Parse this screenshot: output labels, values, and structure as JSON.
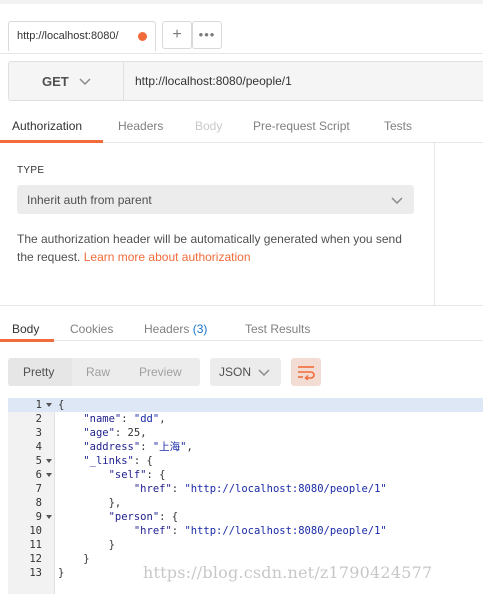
{
  "tab": {
    "label": "http://localhost:8080/",
    "add": "+",
    "more": "•••"
  },
  "request": {
    "method": "GET",
    "url": "http://localhost:8080/people/1"
  },
  "request_tabs": [
    "Authorization",
    "Headers",
    "Body",
    "Pre-request Script",
    "Tests"
  ],
  "auth": {
    "type_label": "TYPE",
    "type_value": "Inherit auth from parent",
    "description": "The authorization header will be automatically generated when you send the request. ",
    "link": "Learn more about authorization"
  },
  "response_tabs": {
    "body": "Body",
    "cookies": "Cookies",
    "headers": "Headers",
    "headers_count": "(3)",
    "tests": "Test Results"
  },
  "view_modes": [
    "Pretty",
    "Raw",
    "Preview"
  ],
  "format": "JSON",
  "code_lines": [
    {
      "n": "1",
      "fold": true,
      "text": "{"
    },
    {
      "n": "2",
      "fold": false,
      "text": "    \"name\": \"dd\","
    },
    {
      "n": "3",
      "fold": false,
      "text": "    \"age\": 25,"
    },
    {
      "n": "4",
      "fold": false,
      "text": "    \"address\": \"上海\","
    },
    {
      "n": "5",
      "fold": true,
      "text": "    \"_links\": {"
    },
    {
      "n": "6",
      "fold": true,
      "text": "        \"self\": {"
    },
    {
      "n": "7",
      "fold": false,
      "text": "            \"href\": \"http://localhost:8080/people/1\""
    },
    {
      "n": "8",
      "fold": false,
      "text": "        },"
    },
    {
      "n": "9",
      "fold": true,
      "text": "        \"person\": {"
    },
    {
      "n": "10",
      "fold": false,
      "text": "            \"href\": \"http://localhost:8080/people/1\""
    },
    {
      "n": "11",
      "fold": false,
      "text": "        }"
    },
    {
      "n": "12",
      "fold": false,
      "text": "    }"
    },
    {
      "n": "13",
      "fold": false,
      "text": "}"
    }
  ],
  "watermark": "https://blog.csdn.net/z1790424577",
  "colors": {
    "accent": "#f26b3a",
    "count": "#1a73c9"
  }
}
